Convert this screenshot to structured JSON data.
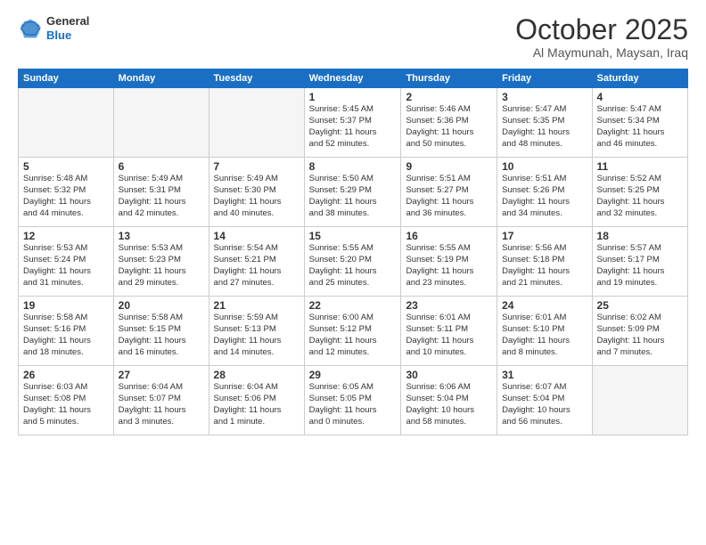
{
  "logo": {
    "general": "General",
    "blue": "Blue"
  },
  "title": "October 2025",
  "subtitle": "Al Maymunah, Maysan, Iraq",
  "days_header": [
    "Sunday",
    "Monday",
    "Tuesday",
    "Wednesday",
    "Thursday",
    "Friday",
    "Saturday"
  ],
  "weeks": [
    [
      {
        "day": "",
        "info": ""
      },
      {
        "day": "",
        "info": ""
      },
      {
        "day": "",
        "info": ""
      },
      {
        "day": "1",
        "info": "Sunrise: 5:45 AM\nSunset: 5:37 PM\nDaylight: 11 hours\nand 52 minutes."
      },
      {
        "day": "2",
        "info": "Sunrise: 5:46 AM\nSunset: 5:36 PM\nDaylight: 11 hours\nand 50 minutes."
      },
      {
        "day": "3",
        "info": "Sunrise: 5:47 AM\nSunset: 5:35 PM\nDaylight: 11 hours\nand 48 minutes."
      },
      {
        "day": "4",
        "info": "Sunrise: 5:47 AM\nSunset: 5:34 PM\nDaylight: 11 hours\nand 46 minutes."
      }
    ],
    [
      {
        "day": "5",
        "info": "Sunrise: 5:48 AM\nSunset: 5:32 PM\nDaylight: 11 hours\nand 44 minutes."
      },
      {
        "day": "6",
        "info": "Sunrise: 5:49 AM\nSunset: 5:31 PM\nDaylight: 11 hours\nand 42 minutes."
      },
      {
        "day": "7",
        "info": "Sunrise: 5:49 AM\nSunset: 5:30 PM\nDaylight: 11 hours\nand 40 minutes."
      },
      {
        "day": "8",
        "info": "Sunrise: 5:50 AM\nSunset: 5:29 PM\nDaylight: 11 hours\nand 38 minutes."
      },
      {
        "day": "9",
        "info": "Sunrise: 5:51 AM\nSunset: 5:27 PM\nDaylight: 11 hours\nand 36 minutes."
      },
      {
        "day": "10",
        "info": "Sunrise: 5:51 AM\nSunset: 5:26 PM\nDaylight: 11 hours\nand 34 minutes."
      },
      {
        "day": "11",
        "info": "Sunrise: 5:52 AM\nSunset: 5:25 PM\nDaylight: 11 hours\nand 32 minutes."
      }
    ],
    [
      {
        "day": "12",
        "info": "Sunrise: 5:53 AM\nSunset: 5:24 PM\nDaylight: 11 hours\nand 31 minutes."
      },
      {
        "day": "13",
        "info": "Sunrise: 5:53 AM\nSunset: 5:23 PM\nDaylight: 11 hours\nand 29 minutes."
      },
      {
        "day": "14",
        "info": "Sunrise: 5:54 AM\nSunset: 5:21 PM\nDaylight: 11 hours\nand 27 minutes."
      },
      {
        "day": "15",
        "info": "Sunrise: 5:55 AM\nSunset: 5:20 PM\nDaylight: 11 hours\nand 25 minutes."
      },
      {
        "day": "16",
        "info": "Sunrise: 5:55 AM\nSunset: 5:19 PM\nDaylight: 11 hours\nand 23 minutes."
      },
      {
        "day": "17",
        "info": "Sunrise: 5:56 AM\nSunset: 5:18 PM\nDaylight: 11 hours\nand 21 minutes."
      },
      {
        "day": "18",
        "info": "Sunrise: 5:57 AM\nSunset: 5:17 PM\nDaylight: 11 hours\nand 19 minutes."
      }
    ],
    [
      {
        "day": "19",
        "info": "Sunrise: 5:58 AM\nSunset: 5:16 PM\nDaylight: 11 hours\nand 18 minutes."
      },
      {
        "day": "20",
        "info": "Sunrise: 5:58 AM\nSunset: 5:15 PM\nDaylight: 11 hours\nand 16 minutes."
      },
      {
        "day": "21",
        "info": "Sunrise: 5:59 AM\nSunset: 5:13 PM\nDaylight: 11 hours\nand 14 minutes."
      },
      {
        "day": "22",
        "info": "Sunrise: 6:00 AM\nSunset: 5:12 PM\nDaylight: 11 hours\nand 12 minutes."
      },
      {
        "day": "23",
        "info": "Sunrise: 6:01 AM\nSunset: 5:11 PM\nDaylight: 11 hours\nand 10 minutes."
      },
      {
        "day": "24",
        "info": "Sunrise: 6:01 AM\nSunset: 5:10 PM\nDaylight: 11 hours\nand 8 minutes."
      },
      {
        "day": "25",
        "info": "Sunrise: 6:02 AM\nSunset: 5:09 PM\nDaylight: 11 hours\nand 7 minutes."
      }
    ],
    [
      {
        "day": "26",
        "info": "Sunrise: 6:03 AM\nSunset: 5:08 PM\nDaylight: 11 hours\nand 5 minutes."
      },
      {
        "day": "27",
        "info": "Sunrise: 6:04 AM\nSunset: 5:07 PM\nDaylight: 11 hours\nand 3 minutes."
      },
      {
        "day": "28",
        "info": "Sunrise: 6:04 AM\nSunset: 5:06 PM\nDaylight: 11 hours\nand 1 minute."
      },
      {
        "day": "29",
        "info": "Sunrise: 6:05 AM\nSunset: 5:05 PM\nDaylight: 11 hours\nand 0 minutes."
      },
      {
        "day": "30",
        "info": "Sunrise: 6:06 AM\nSunset: 5:04 PM\nDaylight: 10 hours\nand 58 minutes."
      },
      {
        "day": "31",
        "info": "Sunrise: 6:07 AM\nSunset: 5:04 PM\nDaylight: 10 hours\nand 56 minutes."
      },
      {
        "day": "",
        "info": ""
      }
    ]
  ]
}
